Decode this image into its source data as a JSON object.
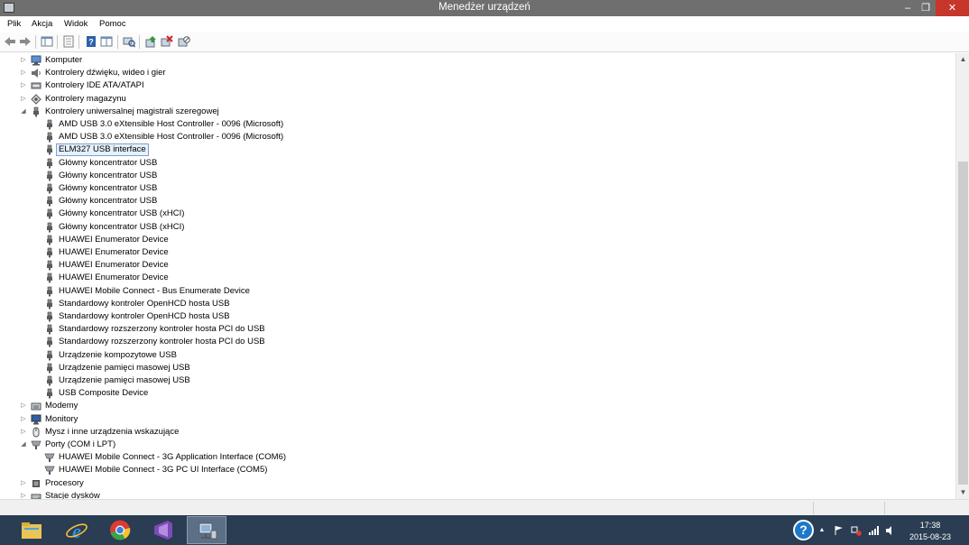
{
  "window": {
    "title": "Menedżer urządzeń"
  },
  "menu": {
    "items": [
      "Plik",
      "Akcja",
      "Widok",
      "Pomoc"
    ]
  },
  "tree": {
    "rows": [
      {
        "label": "Komputer",
        "expander": "▷",
        "icon": "computer-icon",
        "level": 0
      },
      {
        "label": "Kontrolery dźwięku, wideo i gier",
        "expander": "▷",
        "icon": "speaker-icon",
        "level": 0
      },
      {
        "label": "Kontrolery IDE ATA/ATAPI",
        "expander": "▷",
        "icon": "ide-controller-icon",
        "level": 0
      },
      {
        "label": "Kontrolery magazynu",
        "expander": "▷",
        "icon": "storage-controller-icon",
        "level": 0
      },
      {
        "label": "Kontrolery uniwersalnej magistrali szeregowej",
        "expander": "◢",
        "icon": "usb-icon",
        "level": 0
      },
      {
        "label": "AMD USB 3.0 eXtensible Host Controller - 0096 (Microsoft)",
        "expander": "",
        "icon": "usb-icon",
        "level": 1
      },
      {
        "label": "AMD USB 3.0 eXtensible Host Controller - 0096 (Microsoft)",
        "expander": "",
        "icon": "usb-icon",
        "level": 1
      },
      {
        "label": "ELM327 USB interface",
        "expander": "",
        "icon": "usb-icon",
        "level": 1,
        "selected": true
      },
      {
        "label": "Główny koncentrator USB",
        "expander": "",
        "icon": "usb-icon",
        "level": 1
      },
      {
        "label": "Główny koncentrator USB",
        "expander": "",
        "icon": "usb-icon",
        "level": 1
      },
      {
        "label": "Główny koncentrator USB",
        "expander": "",
        "icon": "usb-icon",
        "level": 1
      },
      {
        "label": "Główny koncentrator USB",
        "expander": "",
        "icon": "usb-icon",
        "level": 1
      },
      {
        "label": "Główny koncentrator USB (xHCI)",
        "expander": "",
        "icon": "usb-icon",
        "level": 1
      },
      {
        "label": "Główny koncentrator USB (xHCI)",
        "expander": "",
        "icon": "usb-icon",
        "level": 1
      },
      {
        "label": "HUAWEI Enumerator Device",
        "expander": "",
        "icon": "usb-icon",
        "level": 1
      },
      {
        "label": "HUAWEI Enumerator Device",
        "expander": "",
        "icon": "usb-icon",
        "level": 1
      },
      {
        "label": "HUAWEI Enumerator Device",
        "expander": "",
        "icon": "usb-icon",
        "level": 1
      },
      {
        "label": "HUAWEI Enumerator Device",
        "expander": "",
        "icon": "usb-icon",
        "level": 1
      },
      {
        "label": "HUAWEI Mobile Connect - Bus Enumerate Device",
        "expander": "",
        "icon": "usb-icon",
        "level": 1
      },
      {
        "label": "Standardowy kontroler OpenHCD hosta USB",
        "expander": "",
        "icon": "usb-icon",
        "level": 1
      },
      {
        "label": "Standardowy kontroler OpenHCD hosta USB",
        "expander": "",
        "icon": "usb-icon",
        "level": 1
      },
      {
        "label": "Standardowy rozszerzony kontroler hosta PCI do USB",
        "expander": "",
        "icon": "usb-icon",
        "level": 1
      },
      {
        "label": "Standardowy rozszerzony kontroler hosta PCI do USB",
        "expander": "",
        "icon": "usb-icon",
        "level": 1
      },
      {
        "label": "Urządzenie kompozytowe USB",
        "expander": "",
        "icon": "usb-icon",
        "level": 1
      },
      {
        "label": "Urządzenie pamięci masowej USB",
        "expander": "",
        "icon": "usb-icon",
        "level": 1
      },
      {
        "label": "Urządzenie pamięci masowej USB",
        "expander": "",
        "icon": "usb-icon",
        "level": 1
      },
      {
        "label": "USB Composite Device",
        "expander": "",
        "icon": "usb-icon",
        "level": 1
      },
      {
        "label": "Modemy",
        "expander": "▷",
        "icon": "modem-icon",
        "level": 0
      },
      {
        "label": "Monitory",
        "expander": "▷",
        "icon": "monitor-icon",
        "level": 0
      },
      {
        "label": "Mysz i inne urządzenia wskazujące",
        "expander": "▷",
        "icon": "mouse-icon",
        "level": 0
      },
      {
        "label": "Porty (COM i LPT)",
        "expander": "◢",
        "icon": "port-icon",
        "level": 0
      },
      {
        "label": "HUAWEI Mobile Connect - 3G Application Interface (COM6)",
        "expander": "",
        "icon": "port-icon",
        "level": 1
      },
      {
        "label": "HUAWEI Mobile Connect - 3G PC UI Interface (COM5)",
        "expander": "",
        "icon": "port-icon",
        "level": 1
      },
      {
        "label": "Procesory",
        "expander": "▷",
        "icon": "processor-icon",
        "level": 0
      },
      {
        "label": "Stacje dysków",
        "expander": "▷",
        "icon": "disk-drive-icon",
        "level": 0
      }
    ]
  },
  "taskbar": {
    "apps": [
      "file-explorer-icon",
      "internet-explorer-icon",
      "chrome-icon",
      "visual-studio-icon",
      "device-manager-icon"
    ],
    "help": "?",
    "tray_arrow": "▲",
    "clock_time": "17:38",
    "clock_date": "2015-08-23"
  },
  "colors": {
    "titlebar": "#6f6f6f",
    "close_button": "#c7362b",
    "taskbar": "#2a3d52",
    "selection": "#e5f1fb"
  }
}
